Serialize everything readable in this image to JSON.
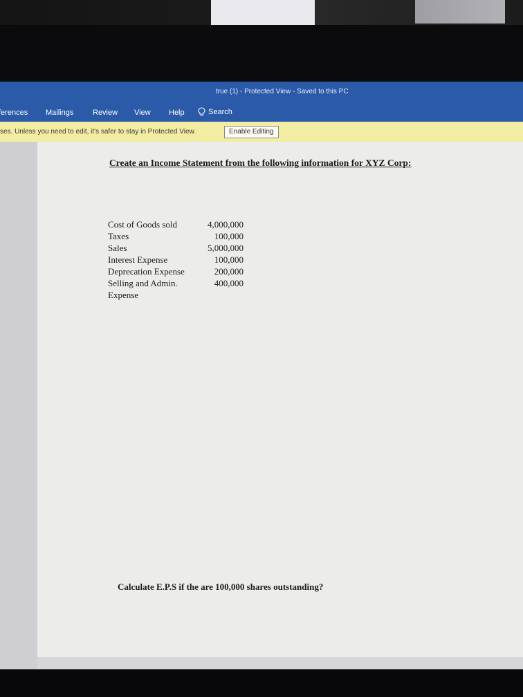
{
  "titlebar": {
    "text": "true (1)  -  Protected View  -  Saved to this PC"
  },
  "ribbon": {
    "tabs": [
      "ferences",
      "Mailings",
      "Review",
      "View",
      "Help"
    ],
    "search_label": "Search"
  },
  "protected_view": {
    "message": "ses. Unless you need to edit, it's safer to stay in Protected View.",
    "button_label": "Enable Editing"
  },
  "document": {
    "heading": "Create an Income Statement from the following information for XYZ Corp:",
    "items": [
      {
        "label": "Cost of Goods sold",
        "value": "4,000,000"
      },
      {
        "label": "Taxes",
        "value": "100,000"
      },
      {
        "label": "Sales",
        "value": "5,000,000"
      },
      {
        "label": "Interest Expense",
        "value": "100,000"
      },
      {
        "label": "Deprecation Expense",
        "value": "200,000"
      },
      {
        "label": "Selling and Admin.",
        "value": "400,000"
      },
      {
        "label": "Expense",
        "value": ""
      }
    ],
    "question": "Calculate E.P.S if the are 100,000 shares outstanding?"
  },
  "colors": {
    "ribbon_blue": "#2b5aa8",
    "protected_yellow": "#f2eda2",
    "page": "#ececea"
  },
  "icons": {
    "search": "lightbulb-search-icon"
  }
}
